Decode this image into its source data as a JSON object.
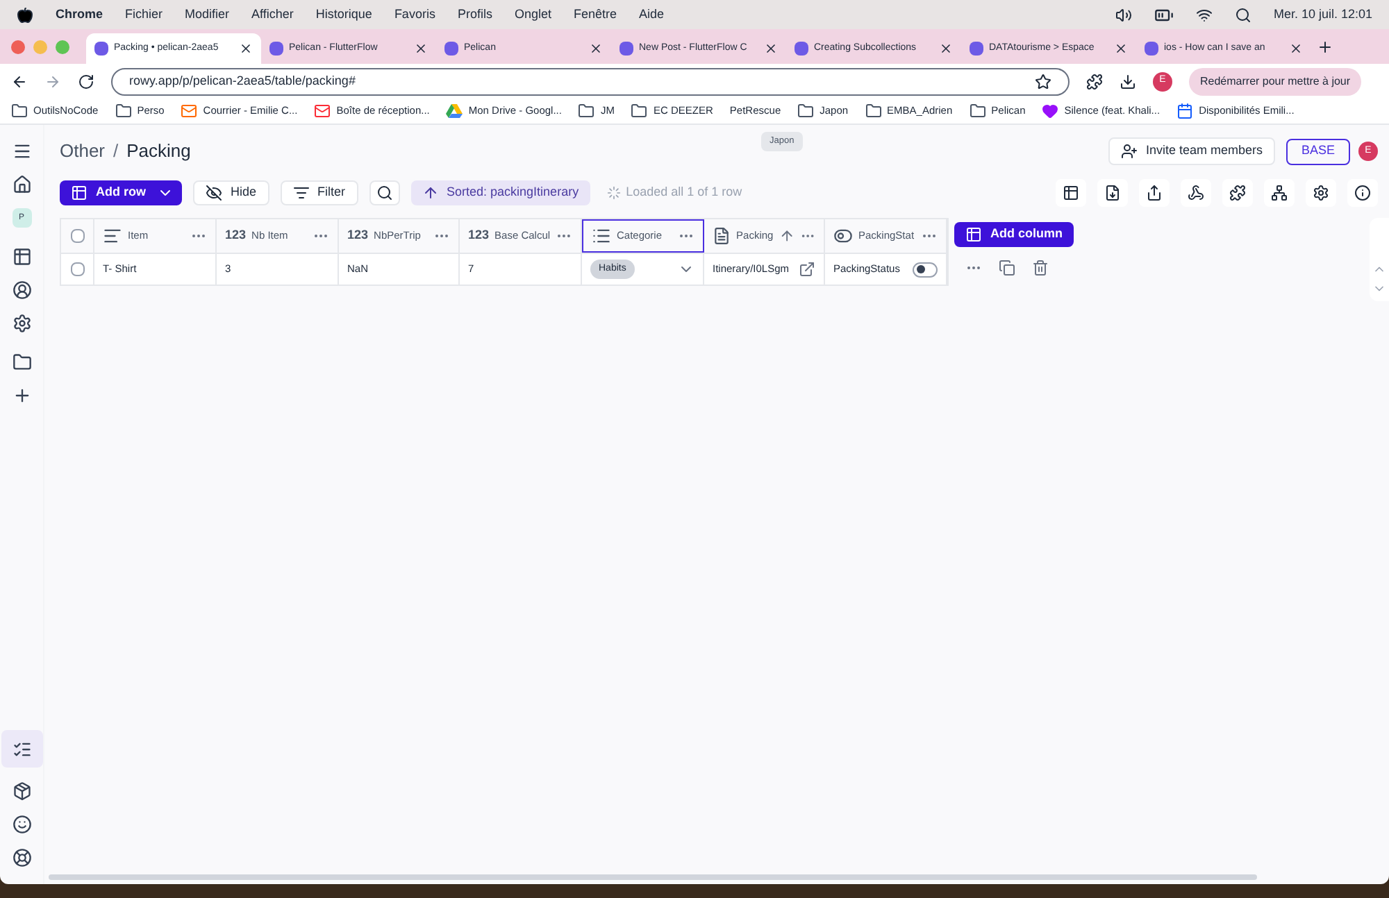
{
  "menu_bar": {
    "app": "Chrome",
    "items": [
      "Fichier",
      "Modifier",
      "Afficher",
      "Historique",
      "Favoris",
      "Profils",
      "Onglet",
      "Fenêtre",
      "Aide"
    ],
    "clock": "Mer. 10 juil.  12:01"
  },
  "tabs": [
    {
      "title": "Packing • pelican-2aea5",
      "selected": true
    },
    {
      "title": "Pelican - FlutterFlow",
      "selected": false
    },
    {
      "title": "Pelican",
      "selected": false
    },
    {
      "title": "New Post - FlutterFlow C",
      "selected": false
    },
    {
      "title": "Creating Subcollections",
      "selected": false
    },
    {
      "title": "DATAtourisme > Espace",
      "selected": false
    },
    {
      "title": "ios - How can I save an",
      "selected": false
    }
  ],
  "address_bar": {
    "url": "rowy.app/p/pelican-2aea5/table/packing#",
    "profile": "E",
    "update_button": "Redémarrer pour mettre à jour"
  },
  "bookmarks": [
    {
      "label": "OutilsNoCode",
      "kind": "folder"
    },
    {
      "label": "Perso",
      "kind": "folder"
    },
    {
      "label": "Courrier - Emilie C...",
      "kind": "mail"
    },
    {
      "label": "Boîte de réception...",
      "kind": "gmail"
    },
    {
      "label": "Mon Drive - Googl...",
      "kind": "drive"
    },
    {
      "label": "JM",
      "kind": "folder"
    },
    {
      "label": "EC DEEZER",
      "kind": "folder"
    },
    {
      "label": "PetRescue",
      "kind": "plain"
    },
    {
      "label": "Japon",
      "kind": "folder"
    },
    {
      "label": "EMBA_Adrien",
      "kind": "folder"
    },
    {
      "label": "Pelican",
      "kind": "folder"
    },
    {
      "label": "Silence (feat. Khali...",
      "kind": "heart"
    },
    {
      "label": "Disponibilités Emili...",
      "kind": "calendar"
    }
  ],
  "tooltip": "Japon",
  "app": {
    "sidebar_badge": "P",
    "breadcrumb": [
      "Other",
      "/",
      "Packing"
    ],
    "select_all_checked": false,
    "invite_button": "Invite team members",
    "base_button": "BASE",
    "avatar": "E",
    "add_row": "Add row",
    "hide": "Hide",
    "filter": "Filter",
    "sort": "Sorted: packingItinerary",
    "loaded": "Loaded all 1 of 1 row",
    "columns": [
      {
        "label": "Item",
        "kind": "text",
        "selected": false
      },
      {
        "label": "Nb Item",
        "kind": "number",
        "type_label": "123",
        "selected": false
      },
      {
        "label": "NbPerTrip",
        "kind": "number",
        "type_label": "123",
        "selected": false
      },
      {
        "label": "Base Calcul",
        "kind": "number",
        "type_label": "123",
        "selected": false
      },
      {
        "label": "Categorie",
        "kind": "select",
        "selected": true
      },
      {
        "label": "Packing",
        "kind": "reference",
        "selected": false
      },
      {
        "label": "PackingStat",
        "kind": "toggle",
        "selected": false
      }
    ],
    "add_column": "Add column",
    "rows": [
      {
        "checked": false,
        "cells": [
          "T- Shirt",
          "3",
          "NaN",
          "7",
          "Habits",
          "Itinerary/I0LSgm",
          "PackingStatus"
        ],
        "packing_status_on": false
      }
    ]
  }
}
